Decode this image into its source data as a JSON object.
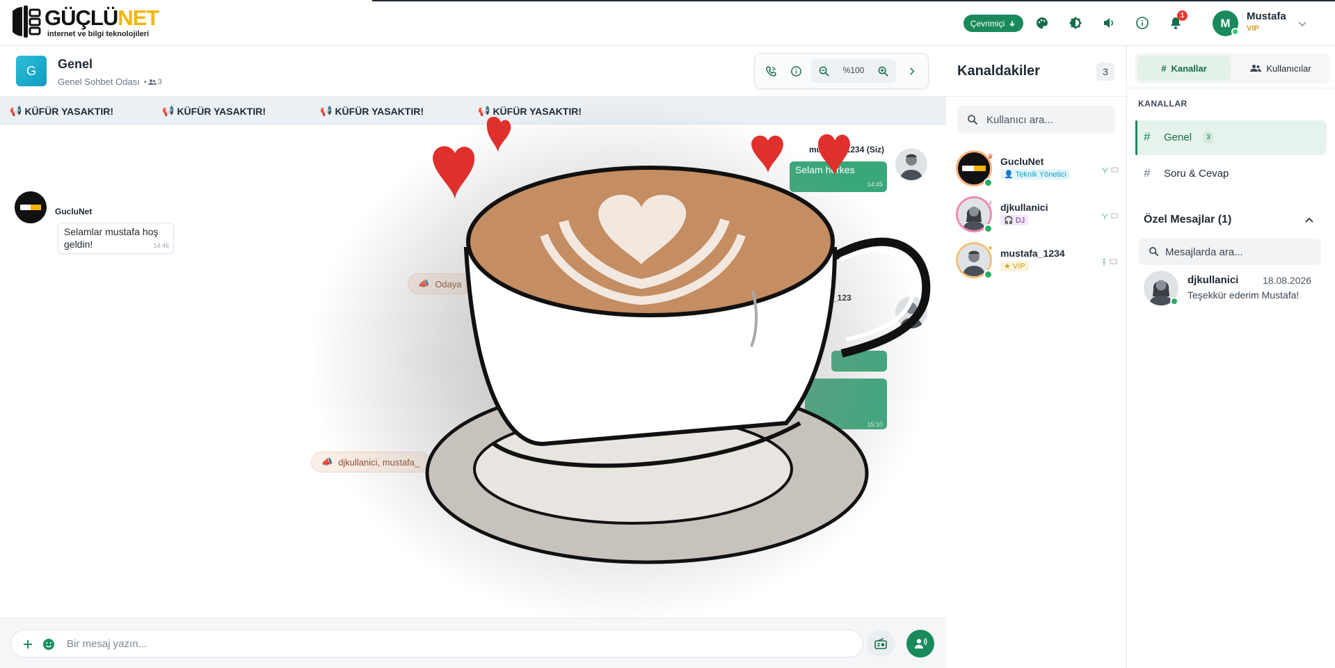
{
  "brand": {
    "word_main": "GÜÇLÜ",
    "word_accent": "NET",
    "tagline": "internet ve bilgi teknolojileri"
  },
  "topbar": {
    "status_label": "Çevrimiçi",
    "notification_count": "1",
    "user_initial": "M",
    "user_name": "Mustafa",
    "user_role": "VIP",
    "icons": [
      "palette-icon",
      "contrast-icon",
      "volume-icon",
      "info-icon",
      "bell-icon",
      "chevron-down-icon"
    ]
  },
  "room": {
    "avatar_letter": "G",
    "title": "Genel",
    "subtitle": "Genel Sohbet Odası",
    "member_count": "3",
    "zoom": "%100"
  },
  "ticker": {
    "items": [
      "KÜFÜR YASAKTIR!",
      "KÜFÜR YASAKTIR!",
      "KÜFÜR YASAKTIR!",
      "KÜFÜR YASAKTIR!"
    ]
  },
  "messages": {
    "mine_sender": "mustafa_1234 (Siz)",
    "mine_text": "Selam herkes",
    "mine_time": "14:45",
    "other_sender": "GucluNet",
    "other_text": "Selamlar mustafa hoş geldin!",
    "other_time": "14:46",
    "system_note_1": "Odaya",
    "system_note_2": "djkullanici, mustafa_",
    "mine_sender_2": "_123",
    "mine_time_3": "15:10"
  },
  "composer": {
    "placeholder": "Bir mesaj yazın..."
  },
  "members": {
    "title": "Kanaldakiler",
    "count": "3",
    "search_placeholder": "Kullanıcı ara...",
    "list": [
      {
        "name": "GucluNet",
        "role": "Teknik Yönetici",
        "role_color": "#17a2c4",
        "role_bg": "#e3f5fa",
        "badge": "♛",
        "badge_color": "#e0533c"
      },
      {
        "name": "djkullanici",
        "role": "DJ",
        "role_color": "#7b2ca6",
        "role_bg": "#f3e8f8",
        "badge": "♪",
        "badge_color": "#d6336c"
      },
      {
        "name": "mustafa_1234",
        "role": "VIP",
        "role_color": "#d4a017",
        "role_bg": "#fbf3dc",
        "badge": "✦",
        "badge_color": "#e0a000"
      }
    ]
  },
  "rightpanel": {
    "tab_channels": "Kanallar",
    "tab_users": "Kullanıcılar",
    "section_label": "KANALLAR",
    "channels": [
      {
        "name": "Genel",
        "count": "3"
      },
      {
        "name": "Soru & Cevap",
        "count": ""
      }
    ],
    "dm_header": "Özel Mesajlar (1)",
    "dm_search_placeholder": "Mesajlarda ara...",
    "dm": {
      "name": "djkullanici",
      "date": "18.08.2026",
      "preview": "Teşekkür ederim Mustafa!"
    }
  },
  "colors": {
    "primary": "#1a8a5c",
    "accent_yellow": "#f5b400",
    "bubble_mine": "#3aa77a",
    "alert_red": "#e53935"
  }
}
